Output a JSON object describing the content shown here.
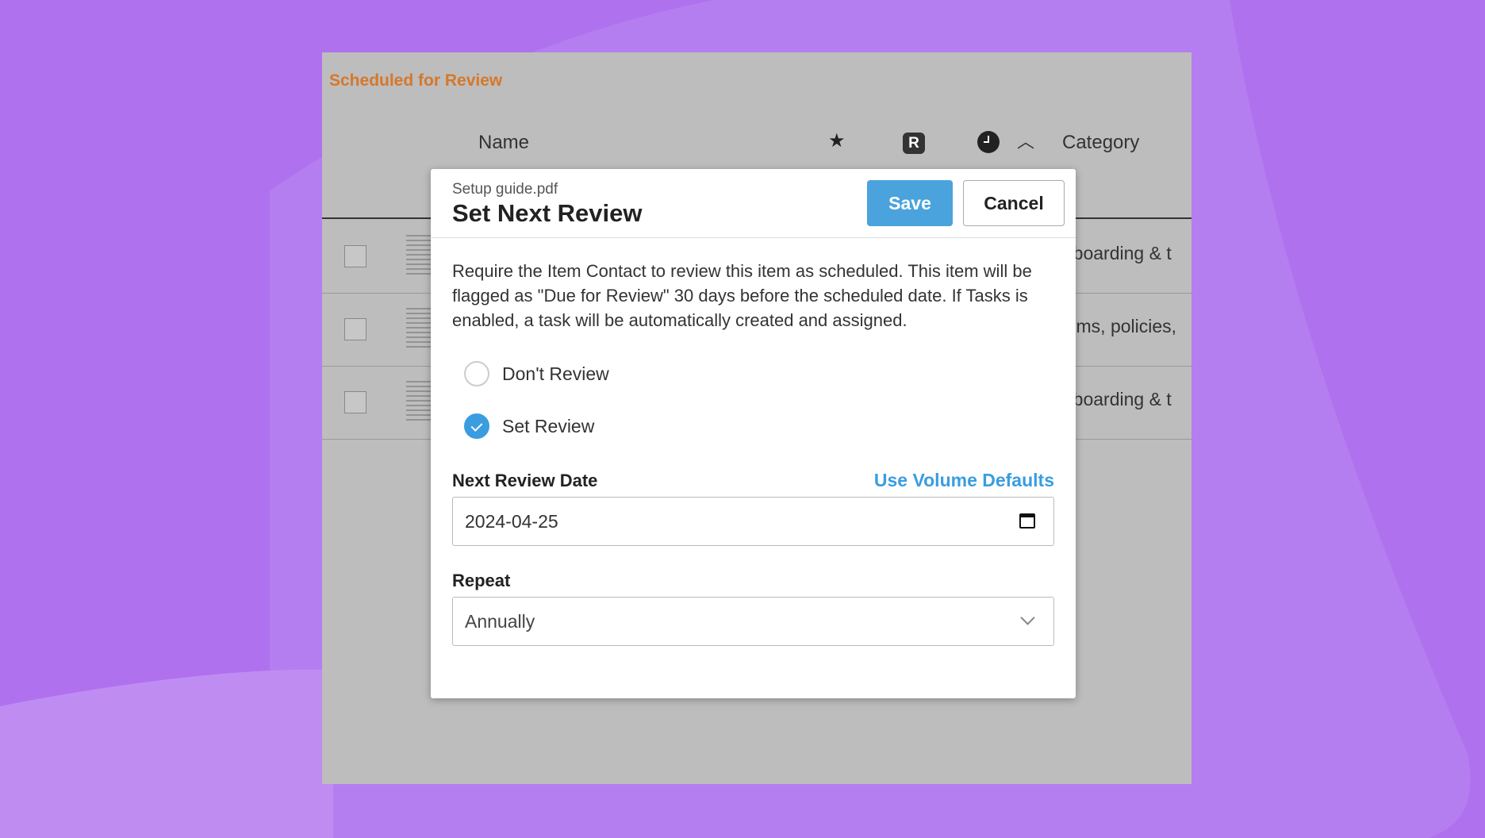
{
  "colors": {
    "background": "#b57ef0",
    "accent": "#4aa3dd",
    "section_title": "#d5782a"
  },
  "app": {
    "section_title": "Scheduled for Review",
    "columns": {
      "name": "Name",
      "star_icon": "star-icon",
      "r_badge": "R",
      "clock_icon": "clock-icon",
      "sort_icon": "chevron-up-icon",
      "category": "Category"
    },
    "rows": [
      {
        "category": "Onboarding & t"
      },
      {
        "category": "Forms, policies,"
      },
      {
        "category": "Onboarding & t"
      }
    ]
  },
  "modal": {
    "file_name": "Setup guide.pdf",
    "title": "Set Next Review",
    "save_label": "Save",
    "cancel_label": "Cancel",
    "description": "Require the Item Contact to review this item as scheduled. This item will be flagged as \"Due for Review\" 30 days before the scheduled date. If Tasks is enabled, a task will be automatically created and assigned.",
    "options": [
      {
        "label": "Don't Review",
        "selected": false
      },
      {
        "label": "Set Review",
        "selected": true
      }
    ],
    "next_review_label": "Next Review Date",
    "use_defaults_label": "Use Volume Defaults",
    "next_review_date": "2024-04-25",
    "repeat_label": "Repeat",
    "repeat_value": "Annually"
  }
}
